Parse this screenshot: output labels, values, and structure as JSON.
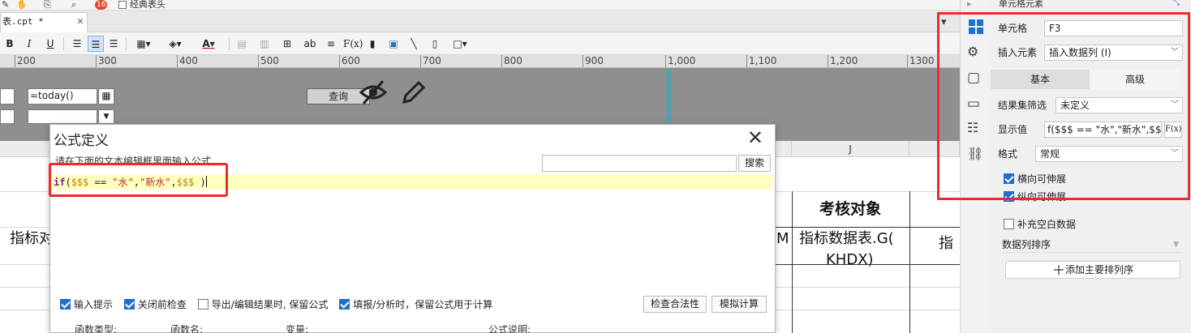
{
  "top_strip": {
    "classic_label": "经典表头",
    "badge": "16"
  },
  "tab": {
    "title": "表.cpt *"
  },
  "toolbar": {
    "bold": "B",
    "italic": "I",
    "underline": "U",
    "text_ab": "ab",
    "formula": "F(x)"
  },
  "ruler": {
    "ticks": [
      "200",
      "300",
      "400",
      "500",
      "600",
      "700",
      "800",
      "900",
      "1,000",
      "1,100",
      "1,200",
      "1300"
    ]
  },
  "params": {
    "date_value": "=today()",
    "query_label": "查询"
  },
  "sheet": {
    "column_j": "J",
    "assess_header": "考核对象",
    "indicator_left": "指标对",
    "m_char": "M",
    "indicator_field_1": "指标数据表.G(",
    "indicator_field_2": "KHDX)",
    "right_char": "指"
  },
  "panel": {
    "header": "单元格元素",
    "cell_label": "单元格",
    "cell_value": "F3",
    "insert_label": "插入元素",
    "insert_value": "插入数据列 (I)",
    "tab_basic": "基本",
    "tab_advanced": "高级",
    "filter_label": "结果集筛选",
    "filter_value": "未定义",
    "display_label": "显示值",
    "display_value": "f($$$ == \"水\",\"新水\",$$$ )",
    "format_label": "格式",
    "format_value": "常规",
    "h_expand": "横向可伸展",
    "v_expand": "纵向可伸展",
    "fill_blank": "补充空白数据",
    "sort_label": "数据列排序",
    "add_sort": "添加主要排列序"
  },
  "dialog": {
    "title": "公式定义",
    "hint": "请在下面的文本编辑框里面输入公式",
    "search_btn": "搜索",
    "code": {
      "kw": "if",
      "open": "(",
      "ph1": "$$$",
      "op": " == ",
      "s1": "\"水\"",
      "comma1": ",",
      "s2": "\"新水\"",
      "comma2": ",",
      "ph2": "$$$",
      "close": " )"
    },
    "opt_hint": "输入提示",
    "opt_check_close": "关闭前检查",
    "opt_export": "导出/编辑结果时, 保留公式",
    "opt_fill": "填报/分析时，保留公式用于计算",
    "check_btn": "检查合法性",
    "simulate_btn": "模拟计算",
    "foot_func_type": "函数类型:",
    "foot_func_name": "函数名:",
    "foot_var": "变量:",
    "foot_desc": "公式说明:"
  },
  "colors": {
    "accent": "#1f6fd0",
    "highlight_red": "#ee2b2b",
    "code_bg": "#ffffbe"
  }
}
